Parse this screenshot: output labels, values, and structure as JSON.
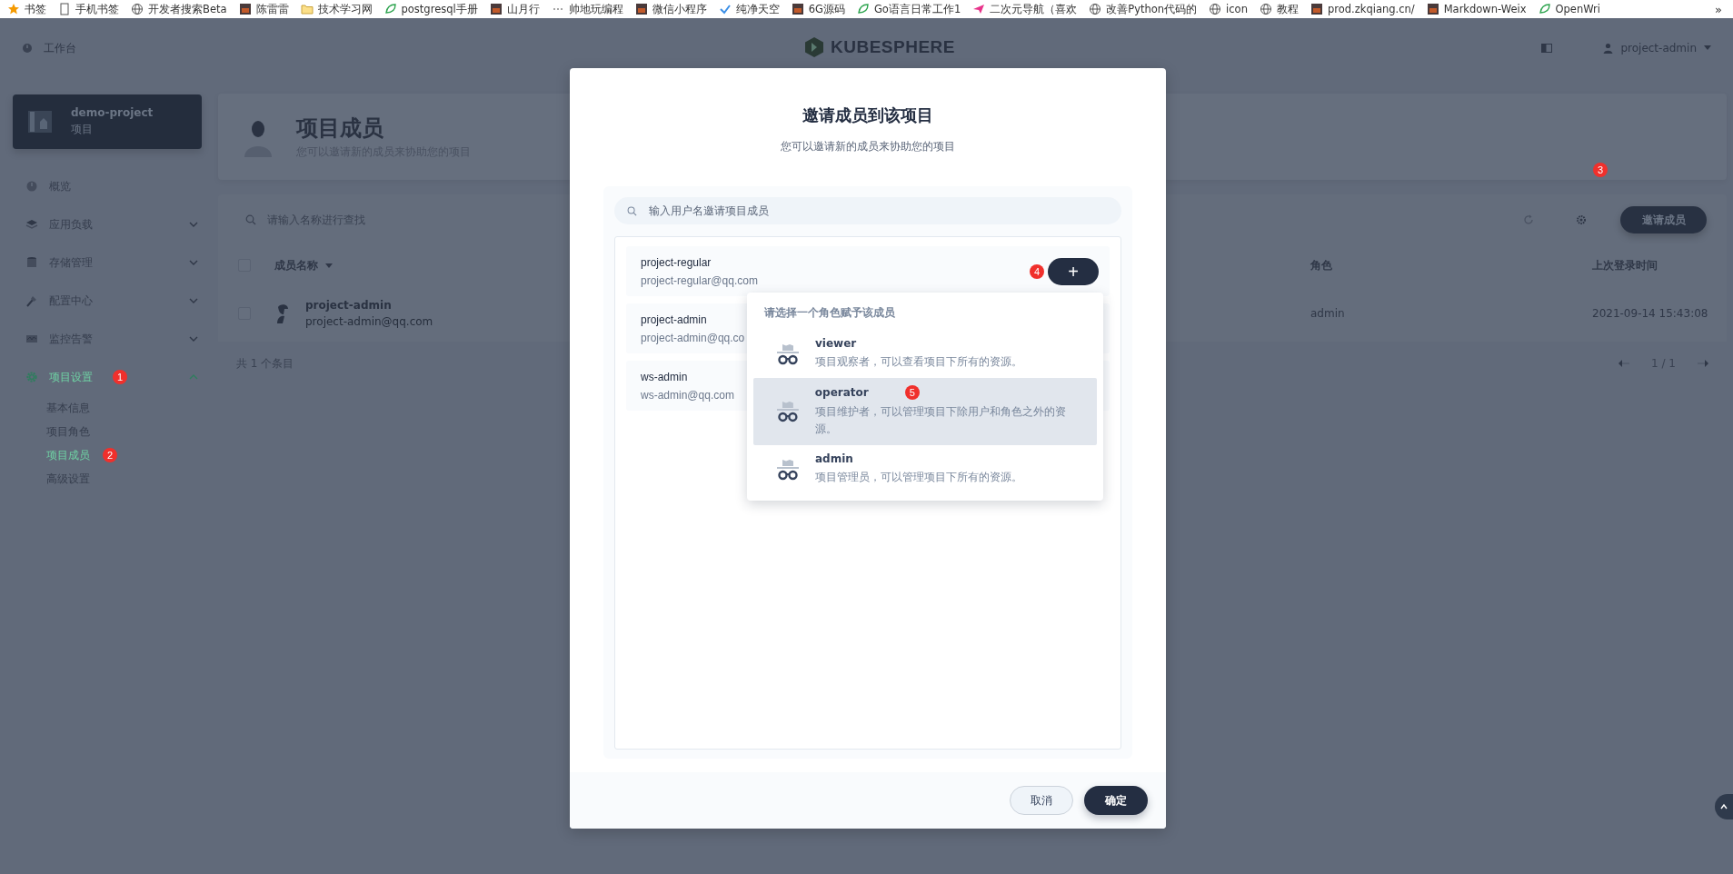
{
  "bookmarks": [
    {
      "label": "书签",
      "kind": "star"
    },
    {
      "label": "手机书签",
      "kind": "page"
    },
    {
      "label": "开发者搜索Beta",
      "kind": "globe"
    },
    {
      "label": "陈雷雷",
      "kind": "image"
    },
    {
      "label": "技术学习网",
      "kind": "folder"
    },
    {
      "label": "postgresql手册",
      "kind": "leaf"
    },
    {
      "label": "山月行",
      "kind": "image"
    },
    {
      "label": "帅地玩编程",
      "kind": "dots"
    },
    {
      "label": "微信小程序",
      "kind": "image"
    },
    {
      "label": "纯净天空",
      "kind": "check"
    },
    {
      "label": "6G源码",
      "kind": "image"
    },
    {
      "label": "Go语言日常工作1",
      "kind": "leaf"
    },
    {
      "label": "二次元导航（喜欢",
      "kind": "plane"
    },
    {
      "label": "改善Python代码的",
      "kind": "globe"
    },
    {
      "label": "icon",
      "kind": "globe"
    },
    {
      "label": "教程",
      "kind": "globe"
    },
    {
      "label": "prod.zkqiang.cn/",
      "kind": "image"
    },
    {
      "label": "Markdown-Weix",
      "kind": "image"
    },
    {
      "label": "OpenWri",
      "kind": "leaf"
    }
  ],
  "bookmarks_more": "»",
  "header": {
    "workbench": "工作台",
    "logo": "KUBESPHERE",
    "user": "project-admin"
  },
  "project": {
    "name": "demo-project",
    "type": "项目"
  },
  "nav": [
    {
      "label": "概览",
      "expandable": false,
      "active": false
    },
    {
      "label": "应用负载",
      "expandable": true,
      "expanded": false,
      "active": false
    },
    {
      "label": "存储管理",
      "expandable": true,
      "expanded": false,
      "active": false
    },
    {
      "label": "配置中心",
      "expandable": true,
      "expanded": false,
      "active": false
    },
    {
      "label": "监控告警",
      "expandable": true,
      "expanded": false,
      "active": false
    },
    {
      "label": "项目设置",
      "expandable": true,
      "expanded": true,
      "active": true,
      "annotation": "1",
      "children": [
        {
          "label": "基本信息",
          "selected": false
        },
        {
          "label": "项目角色",
          "selected": false
        },
        {
          "label": "项目成员",
          "selected": true,
          "annotation": "2"
        },
        {
          "label": "高级设置",
          "selected": false
        }
      ]
    }
  ],
  "page_header": {
    "title": "项目成员",
    "subtitle": "您可以邀请新的成员来协助您的项目"
  },
  "toolbar": {
    "search_placeholder": "请输入名称进行查找",
    "invite_button": "邀请成员",
    "annotation": "3"
  },
  "table": {
    "select_all_checked": false,
    "columns": [
      "成员名称",
      "角色",
      "上次登录时间"
    ],
    "rows": [
      {
        "name": "project-admin",
        "email": "project-admin@qq.com",
        "role": "admin",
        "last_login": "2021-09-14 15:43:08",
        "checked": false
      }
    ]
  },
  "footer": {
    "total": "共 1 个条目",
    "page": "1 / 1"
  },
  "dialog": {
    "title": "邀请成员到该项目",
    "subtitle": "您可以邀请新的成员来协助您的项目",
    "search_placeholder": "输入用户名邀请项目成员",
    "users": [
      {
        "name": "project-regular",
        "email": "project-regular@qq.com",
        "add_button": "+",
        "annotation": "4"
      },
      {
        "name": "project-admin",
        "email": "project-admin@qq.co"
      },
      {
        "name": "ws-admin",
        "email": "ws-admin@qq.com"
      }
    ],
    "role_menu": {
      "heading": "请选择一个角色赋予该成员",
      "roles": [
        {
          "name": "viewer",
          "description": "项目观察者，可以查看项目下所有的资源。",
          "selected": false
        },
        {
          "name": "operator",
          "description": "项目维护者，可以管理项目下除用户和角色之外的资源。",
          "selected": true,
          "annotation": "5"
        },
        {
          "name": "admin",
          "description": "项目管理员，可以管理项目下所有的资源。",
          "selected": false
        }
      ]
    },
    "cancel": "取消",
    "ok": "确定"
  }
}
